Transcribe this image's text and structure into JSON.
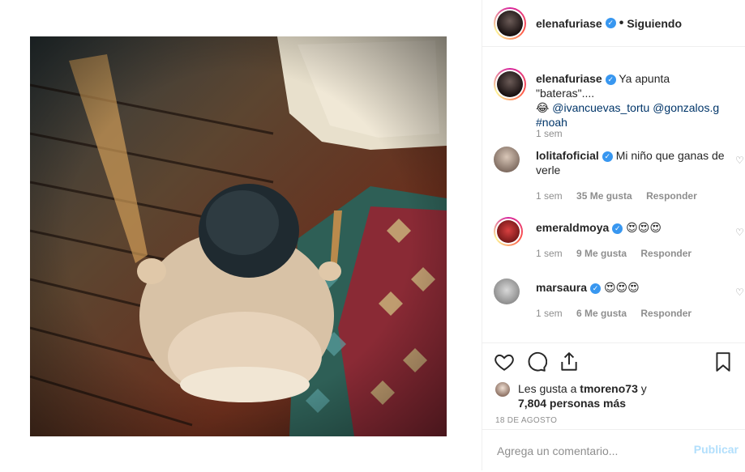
{
  "post": {
    "author": "elenafuriase",
    "follow_status": "Siguiendo",
    "dot": "•",
    "verified": "✓"
  },
  "caption": {
    "username": "elenafuriase",
    "text": "Ya apunta \"bateras\"....",
    "emoji": "😂",
    "mention1": "@ivancuevas_tortu",
    "mention2": "@gonzalos.g",
    "hashtag": "#noah",
    "time": "1 sem"
  },
  "comments": [
    {
      "username": "lolitafoficial",
      "text": "Mi niño que ganas de verle",
      "time": "1 sem",
      "likes": "35 Me gusta",
      "reply": "Responder"
    },
    {
      "username": "emeraldmoya",
      "text": "😍😍😍",
      "time": "1 sem",
      "likes": "9 Me gusta",
      "reply": "Responder"
    },
    {
      "username": "marsaura",
      "text": "😍😍😍",
      "time": "1 sem",
      "likes": "6 Me gusta",
      "reply": "Responder"
    }
  ],
  "likes": {
    "prefix": "Les gusta a",
    "user": "tmoreno73",
    "joiner": "y",
    "count": "7,804 personas más"
  },
  "date": "18 DE AGOSTO",
  "add_comment": {
    "placeholder": "Agrega un comentario...",
    "publish": "Publicar"
  },
  "colors": {
    "link": "#003569",
    "verified": "#3897f0",
    "publish_disabled": "#b2dffc"
  }
}
